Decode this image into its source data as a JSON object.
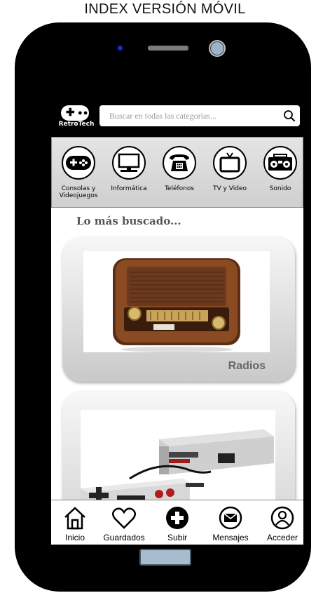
{
  "page_heading": "INDEX VERSIÓN MÓVIL",
  "header": {
    "logo_text": "RetroTech",
    "search_placeholder": "Buscar en todas las categorías..."
  },
  "categories": [
    {
      "label_line1": "Consolas y",
      "label_line2": "Videojuegos",
      "icon": "gamepad-icon"
    },
    {
      "label_line1": "Informática",
      "label_line2": "",
      "icon": "monitor-icon"
    },
    {
      "label_line1": "Teléfonos",
      "label_line2": "",
      "icon": "telephone-icon"
    },
    {
      "label_line1": "TV y Video",
      "label_line2": "",
      "icon": "tv-icon"
    },
    {
      "label_line1": "Sonido",
      "label_line2": "",
      "icon": "boombox-icon"
    }
  ],
  "main": {
    "section_title": "Lo más buscado...",
    "cards": [
      {
        "label": "Radios",
        "image": "vintage-radio"
      },
      {
        "label": "",
        "image": "nes-console"
      }
    ]
  },
  "bottom_nav": [
    {
      "label": "Inicio",
      "icon": "home-icon"
    },
    {
      "label": "Guardados",
      "icon": "heart-icon"
    },
    {
      "label": "Subir",
      "icon": "plus-circle-icon"
    },
    {
      "label": "Mensajes",
      "icon": "envelope-icon"
    },
    {
      "label": "Acceder",
      "icon": "user-icon"
    }
  ],
  "colors": {
    "phone_body": "#000000",
    "category_bar": "#d9d9d9",
    "camera_dot": "#1a2bd6",
    "home_button": "#a8bcd0"
  }
}
